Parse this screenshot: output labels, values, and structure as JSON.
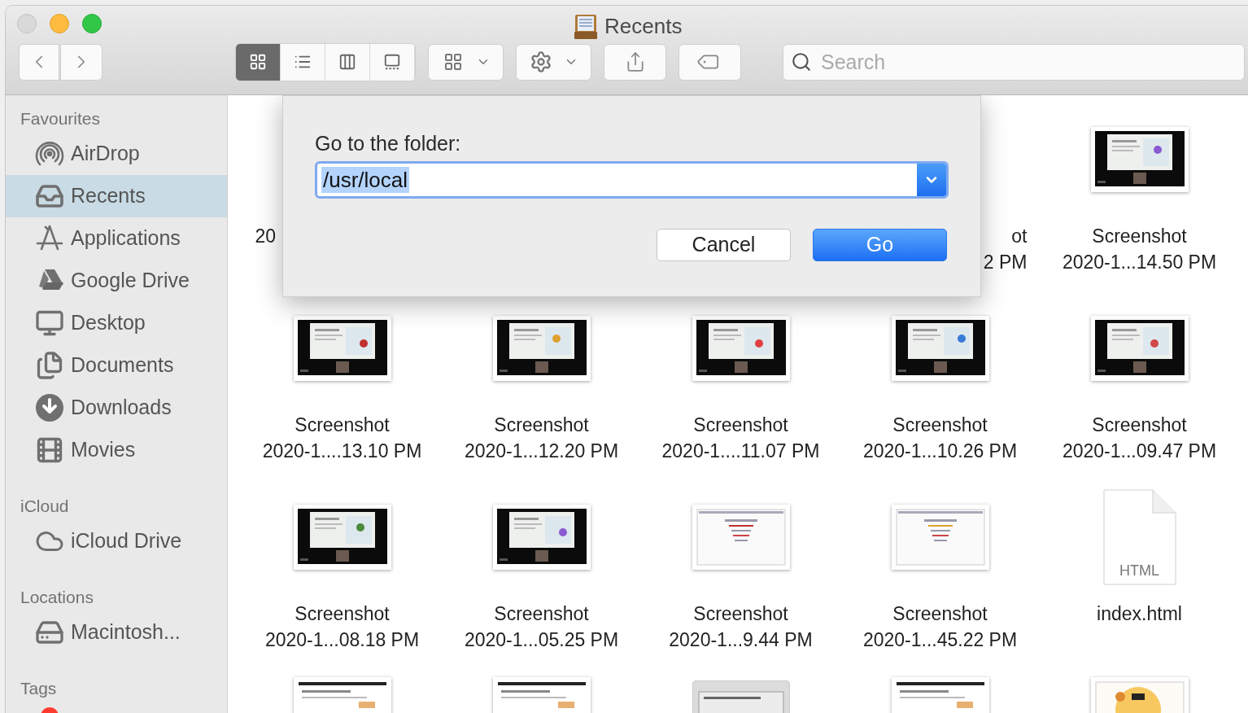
{
  "window": {
    "title": "Recents"
  },
  "toolbar": {
    "view_modes": [
      {
        "kind": "icons",
        "selected": true
      },
      {
        "kind": "list",
        "selected": false
      },
      {
        "kind": "columns",
        "selected": false
      },
      {
        "kind": "gallery",
        "selected": false
      }
    ],
    "search": {
      "placeholder": "Search"
    }
  },
  "sidebar": {
    "sections": [
      {
        "title": "Favourites",
        "items": [
          {
            "kind": "airdrop",
            "label": "AirDrop",
            "selected": false
          },
          {
            "kind": "recents",
            "label": "Recents",
            "selected": true
          },
          {
            "kind": "applications",
            "label": "Applications",
            "selected": false
          },
          {
            "kind": "gdrive",
            "label": "Google Drive",
            "selected": false
          },
          {
            "kind": "desktop",
            "label": "Desktop",
            "selected": false
          },
          {
            "kind": "documents",
            "label": "Documents",
            "selected": false
          },
          {
            "kind": "downloads",
            "label": "Downloads",
            "selected": false
          },
          {
            "kind": "movies",
            "label": "Movies",
            "selected": false
          }
        ]
      },
      {
        "title": "iCloud",
        "items": [
          {
            "kind": "cloud",
            "label": "iCloud Drive",
            "selected": false
          }
        ]
      },
      {
        "title": "Locations",
        "items": [
          {
            "kind": "disk",
            "label": "Macintosh...",
            "selected": false
          }
        ]
      },
      {
        "title": "Tags",
        "items": [
          {
            "kind": "tag",
            "color": "#ff3b30",
            "selected": false
          }
        ]
      }
    ]
  },
  "files": [
    [
      {
        "kind": "covered",
        "lines": [
          "20"
        ],
        "cut_at_end": true
      },
      {
        "kind": "covered"
      },
      {
        "kind": "covered"
      },
      {
        "kind": "covered",
        "lines": [
          "ot",
          "2 PM"
        ],
        "cut_at_start": true
      },
      {
        "kind": "dark-screenshot",
        "lines": [
          "Screenshot",
          "2020-1...14.50 PM"
        ]
      }
    ],
    [
      {
        "kind": "dark-screenshot",
        "lines": [
          "Screenshot",
          "2020-1....13.10 PM"
        ]
      },
      {
        "kind": "dark-screenshot",
        "lines": [
          "Screenshot",
          "2020-1...12.20 PM"
        ]
      },
      {
        "kind": "dark-screenshot",
        "lines": [
          "Screenshot",
          "2020-1....11.07 PM"
        ]
      },
      {
        "kind": "dark-screenshot",
        "lines": [
          "Screenshot",
          "2020-1...10.26 PM"
        ]
      },
      {
        "kind": "dark-screenshot",
        "lines": [
          "Screenshot",
          "2020-1...09.47 PM"
        ]
      }
    ],
    [
      {
        "kind": "dark-screenshot",
        "lines": [
          "Screenshot",
          "2020-1...08.18 PM"
        ]
      },
      {
        "kind": "dark-screenshot",
        "lines": [
          "Screenshot",
          "2020-1...05.25 PM"
        ]
      },
      {
        "kind": "page-screenshot",
        "lines": [
          "Screenshot",
          "2020-1...9.44 PM"
        ]
      },
      {
        "kind": "page-screenshot",
        "lines": [
          "Screenshot",
          "2020-1...45.22 PM"
        ]
      },
      {
        "kind": "html-file",
        "badge": "HTML",
        "lines": [
          "index.html"
        ]
      }
    ],
    [
      {
        "kind": "partial-page"
      },
      {
        "kind": "partial-page"
      },
      {
        "kind": "partial-grey"
      },
      {
        "kind": "partial-page"
      },
      {
        "kind": "partial-orange"
      }
    ]
  ],
  "dialog": {
    "label": "Go to the folder:",
    "value": "/usr/local",
    "buttons": [
      {
        "kind": "cancel",
        "label": "Cancel"
      },
      {
        "kind": "default",
        "label": "Go"
      }
    ]
  }
}
